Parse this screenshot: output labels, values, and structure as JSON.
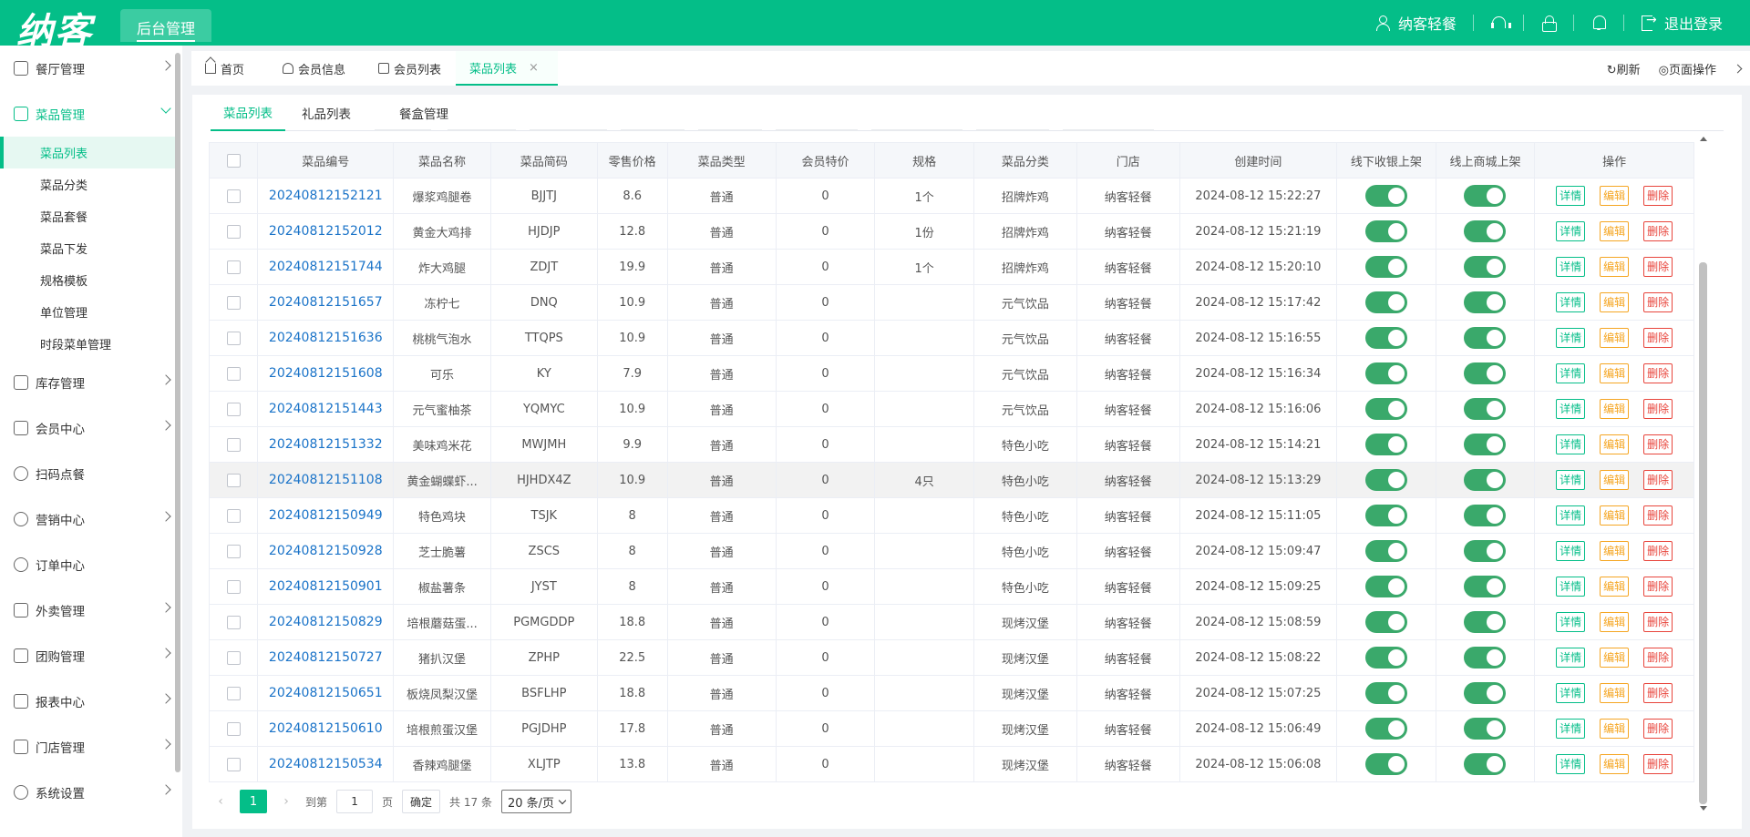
{
  "header": {
    "logo": "纳客",
    "admin_tab": "后台管理",
    "user_name": "纳客轻餐",
    "logout": "退出登录"
  },
  "sidebar": {
    "menus": [
      {
        "label": "餐厅管理",
        "icon": "building-icon"
      },
      {
        "label": "菜品管理",
        "icon": "layout-icon",
        "open": true
      },
      {
        "label": "库存管理",
        "icon": "box-icon"
      },
      {
        "label": "会员中心",
        "icon": "crown-icon"
      },
      {
        "label": "扫码点餐",
        "icon": "person-icon"
      },
      {
        "label": "营销中心",
        "icon": "target-icon"
      },
      {
        "label": "订单中心",
        "icon": "globe-icon"
      },
      {
        "label": "外卖管理",
        "icon": "delivery-icon"
      },
      {
        "label": "团购管理",
        "icon": "calendar-icon"
      },
      {
        "label": "报表中心",
        "icon": "bar-chart-icon"
      },
      {
        "label": "门店管理",
        "icon": "store-icon"
      },
      {
        "label": "系统设置",
        "icon": "gear-icon"
      }
    ],
    "submenu": [
      "菜品列表",
      "菜品分类",
      "菜品套餐",
      "菜品下发",
      "规格模板",
      "单位管理",
      "时段菜单管理"
    ]
  },
  "tabs": {
    "items": [
      "首页",
      "会员信息",
      "会员列表",
      "菜品列表"
    ],
    "refresh": "刷新",
    "page_ops": "页面操作"
  },
  "subtabs": [
    "菜品列表",
    "礼品列表",
    "餐盒管理"
  ],
  "table": {
    "columns": [
      "菜品编号",
      "菜品名称",
      "菜品简码",
      "零售价格",
      "菜品类型",
      "会员特价",
      "规格",
      "菜品分类",
      "门店",
      "创建时间",
      "线下收银上架",
      "线上商城上架",
      "操作"
    ],
    "actions": {
      "detail": "详情",
      "edit": "编辑",
      "delete": "删除"
    },
    "rows": [
      {
        "code": "20240812152121",
        "name": "爆浆鸡腿卷",
        "short": "BJJTJ",
        "price": "8.6",
        "type": "普通",
        "member": "0",
        "spec": "1个",
        "category": "招牌炸鸡",
        "store": "纳客轻餐",
        "created": "2024-08-12 15:22:27"
      },
      {
        "code": "20240812152012",
        "name": "黄金大鸡排",
        "short": "HJDJP",
        "price": "12.8",
        "type": "普通",
        "member": "0",
        "spec": "1份",
        "category": "招牌炸鸡",
        "store": "纳客轻餐",
        "created": "2024-08-12 15:21:19"
      },
      {
        "code": "20240812151744",
        "name": "炸大鸡腿",
        "short": "ZDJT",
        "price": "19.9",
        "type": "普通",
        "member": "0",
        "spec": "1个",
        "category": "招牌炸鸡",
        "store": "纳客轻餐",
        "created": "2024-08-12 15:20:10"
      },
      {
        "code": "20240812151657",
        "name": "冻柠七",
        "short": "DNQ",
        "price": "10.9",
        "type": "普通",
        "member": "0",
        "spec": "",
        "category": "元气饮品",
        "store": "纳客轻餐",
        "created": "2024-08-12 15:17:42"
      },
      {
        "code": "20240812151636",
        "name": "桃桃气泡水",
        "short": "TTQPS",
        "price": "10.9",
        "type": "普通",
        "member": "0",
        "spec": "",
        "category": "元气饮品",
        "store": "纳客轻餐",
        "created": "2024-08-12 15:16:55"
      },
      {
        "code": "20240812151608",
        "name": "可乐",
        "short": "KY",
        "price": "7.9",
        "type": "普通",
        "member": "0",
        "spec": "",
        "category": "元气饮品",
        "store": "纳客轻餐",
        "created": "2024-08-12 15:16:34"
      },
      {
        "code": "20240812151443",
        "name": "元气蜜柚茶",
        "short": "YQMYC",
        "price": "10.9",
        "type": "普通",
        "member": "0",
        "spec": "",
        "category": "元气饮品",
        "store": "纳客轻餐",
        "created": "2024-08-12 15:16:06"
      },
      {
        "code": "20240812151332",
        "name": "美味鸡米花",
        "short": "MWJMH",
        "price": "9.9",
        "type": "普通",
        "member": "0",
        "spec": "",
        "category": "特色小吃",
        "store": "纳客轻餐",
        "created": "2024-08-12 15:14:21"
      },
      {
        "code": "20240812151108",
        "name": "黄金蝴蝶虾...",
        "short": "HJHDX4Z",
        "price": "10.9",
        "type": "普通",
        "member": "0",
        "spec": "4只",
        "category": "特色小吃",
        "store": "纳客轻餐",
        "created": "2024-08-12 15:13:29"
      },
      {
        "code": "20240812150949",
        "name": "特色鸡块",
        "short": "TSJK",
        "price": "8",
        "type": "普通",
        "member": "0",
        "spec": "",
        "category": "特色小吃",
        "store": "纳客轻餐",
        "created": "2024-08-12 15:11:05"
      },
      {
        "code": "20240812150928",
        "name": "芝士脆薯",
        "short": "ZSCS",
        "price": "8",
        "type": "普通",
        "member": "0",
        "spec": "",
        "category": "特色小吃",
        "store": "纳客轻餐",
        "created": "2024-08-12 15:09:47"
      },
      {
        "code": "20240812150901",
        "name": "椒盐薯条",
        "short": "JYST",
        "price": "8",
        "type": "普通",
        "member": "0",
        "spec": "",
        "category": "特色小吃",
        "store": "纳客轻餐",
        "created": "2024-08-12 15:09:25"
      },
      {
        "code": "20240812150829",
        "name": "培根蘑菇蛋...",
        "short": "PGMGDDP",
        "price": "18.8",
        "type": "普通",
        "member": "0",
        "spec": "",
        "category": "现烤汉堡",
        "store": "纳客轻餐",
        "created": "2024-08-12 15:08:59"
      },
      {
        "code": "20240812150727",
        "name": "猪扒汉堡",
        "short": "ZPHP",
        "price": "22.5",
        "type": "普通",
        "member": "0",
        "spec": "",
        "category": "现烤汉堡",
        "store": "纳客轻餐",
        "created": "2024-08-12 15:08:22"
      },
      {
        "code": "20240812150651",
        "name": "板烧凤梨汉堡",
        "short": "BSFLHP",
        "price": "18.8",
        "type": "普通",
        "member": "0",
        "spec": "",
        "category": "现烤汉堡",
        "store": "纳客轻餐",
        "created": "2024-08-12 15:07:25"
      },
      {
        "code": "20240812150610",
        "name": "培根煎蛋汉堡",
        "short": "PGJDHP",
        "price": "17.8",
        "type": "普通",
        "member": "0",
        "spec": "",
        "category": "现烤汉堡",
        "store": "纳客轻餐",
        "created": "2024-08-12 15:06:49"
      },
      {
        "code": "20240812150534",
        "name": "香辣鸡腿堡",
        "short": "XLJTP",
        "price": "13.8",
        "type": "普通",
        "member": "0",
        "spec": "",
        "category": "现烤汉堡",
        "store": "纳客轻餐",
        "created": "2024-08-12 15:06:08"
      }
    ]
  },
  "pagination": {
    "current": "1",
    "goto_label": "到第",
    "goto_value": "1",
    "page_unit": "页",
    "confirm": "确定",
    "total": "共 17 条",
    "page_size": "20 条/页"
  },
  "colors": {
    "brand": "#04be88",
    "toggle_on": "#3aa96b",
    "link": "#1a73c8",
    "edit": "#f5a623",
    "delete": "#e8453c"
  }
}
